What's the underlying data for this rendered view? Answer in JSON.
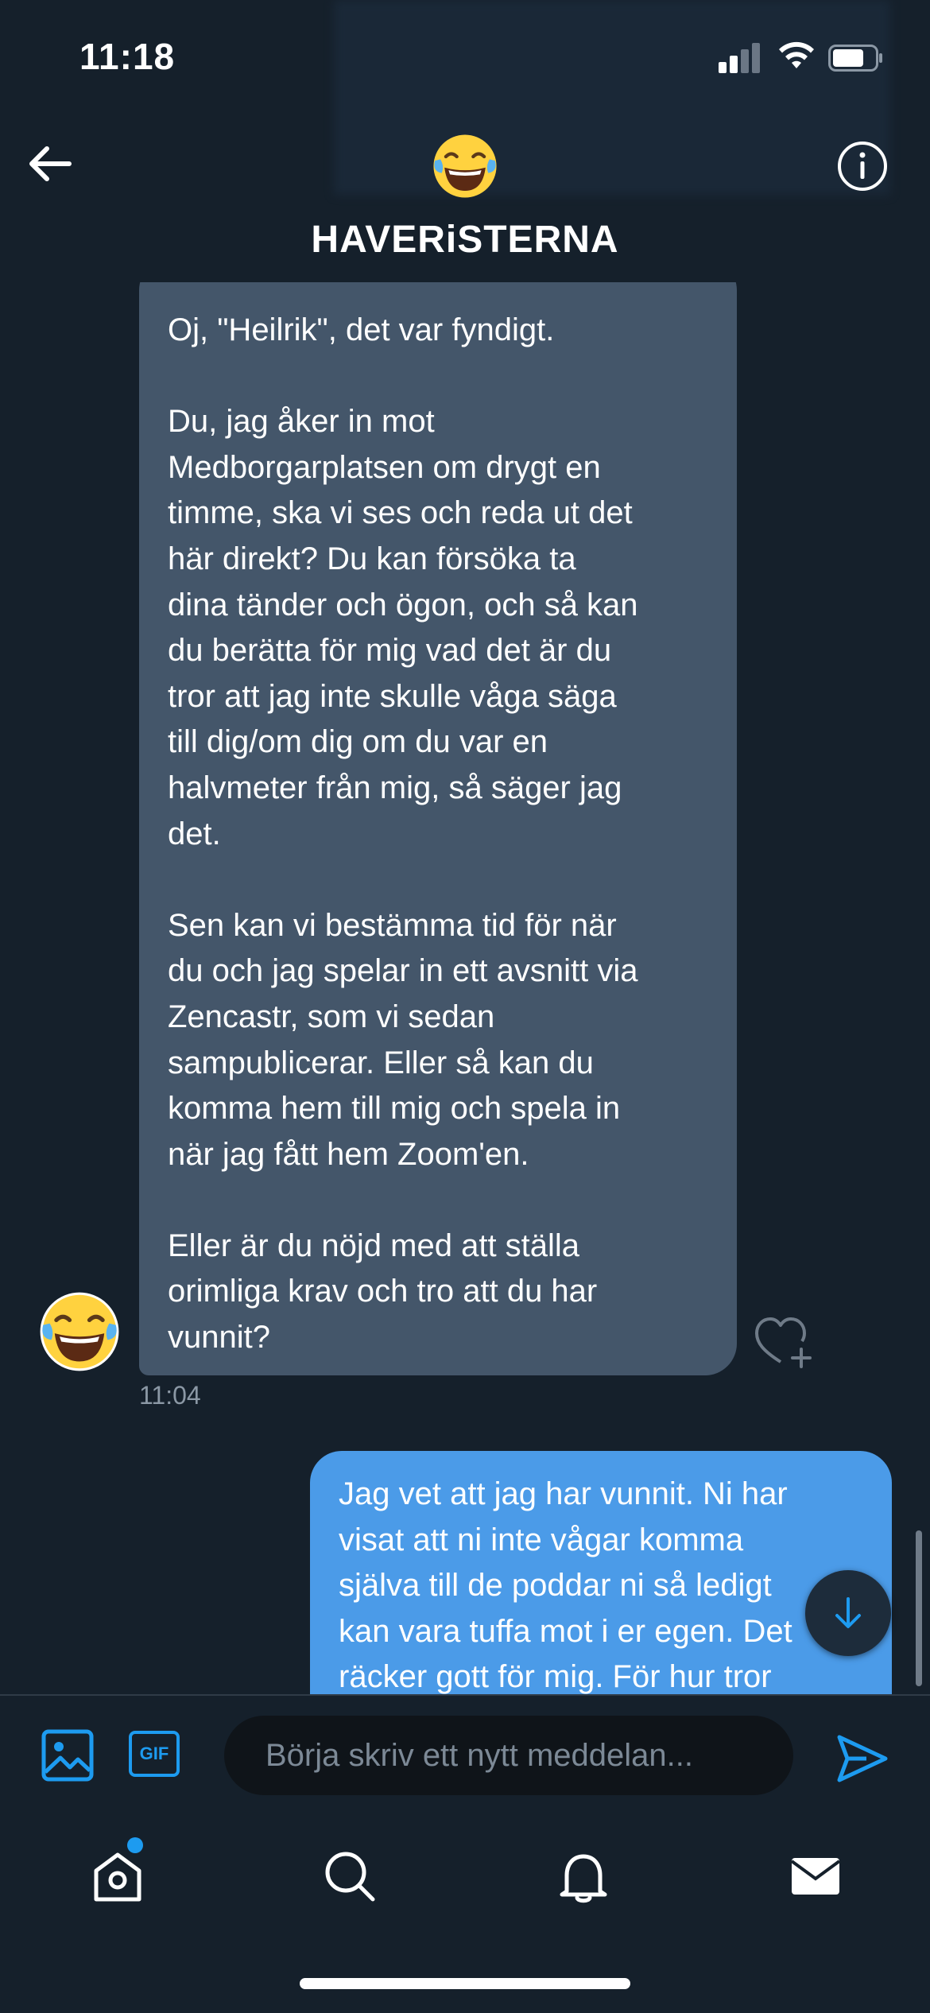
{
  "status_bar": {
    "time": "11:18"
  },
  "header": {
    "group_name": "HAVERiSTERNA",
    "avatar_icon": "laughing-tears-emoji"
  },
  "messages": {
    "incoming": {
      "text": "Oj, \"Heilrik\", det var fyndigt.\n\nDu, jag åker in mot\nMedborgarplatsen om drygt en\ntimme, ska vi ses och reda ut det\nhär direkt? Du kan försöka ta\ndina tänder och ögon, och så kan\ndu berätta för mig vad det är du\ntror att jag inte skulle våga säga\ntill dig/om dig om du var en\nhalvmeter från mig, så säger jag\ndet.\n\nSen kan vi bestämma tid för när\ndu och jag spelar in ett avsnitt via\nZencastr, som vi sedan\nsampublicerar. Eller så kan du\nkomma hem till mig och spela in\nnär jag fått hem Zoom'en.\n\nEller är du nöjd med att ställa\norimliga krav och tro att du har\nvunnit?",
      "time": "11:04"
    },
    "outgoing": {
      "text": "Jag vet att jag har vunnit. Ni har\nvisat att ni inte vågar komma\nsjälva till de poddar ni så ledigt\nkan vara tuffa mot i er egen. Det\nräcker gott för mig. För hur tror"
    }
  },
  "composer": {
    "gif_label": "GIF",
    "placeholder": "Börja skriv ett nytt meddelan..."
  },
  "colors": {
    "background": "#15202b",
    "incoming_bubble": "#44566a",
    "outgoing_bubble": "#4b9be8",
    "accent": "#1d9bf0"
  }
}
